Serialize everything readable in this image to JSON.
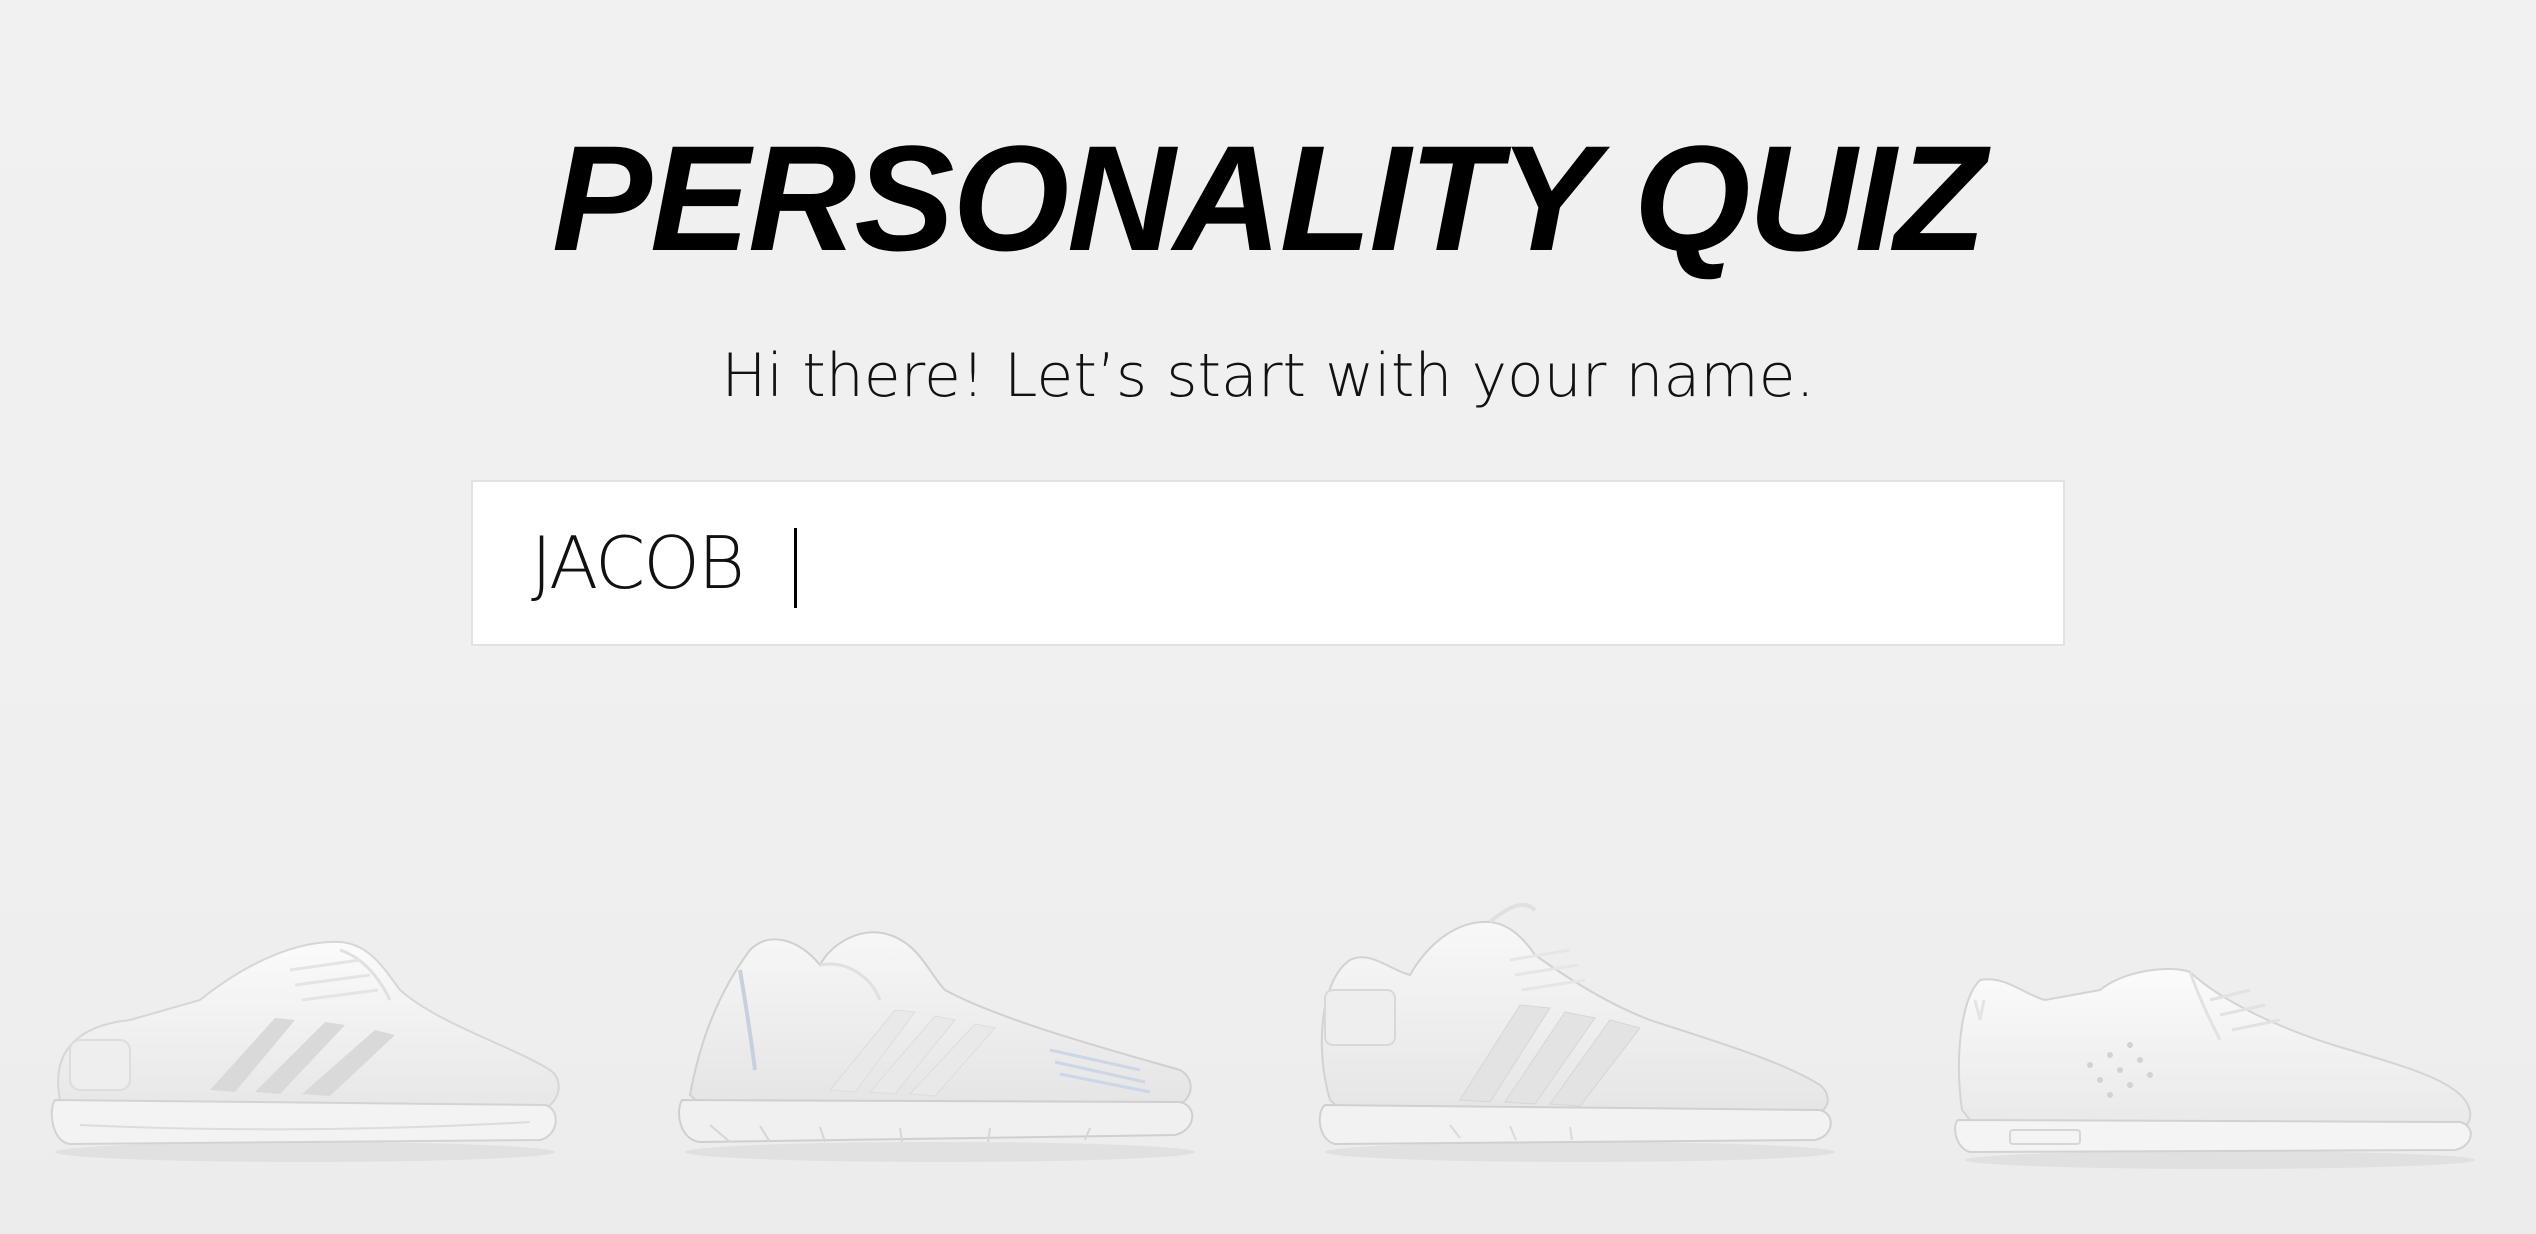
{
  "quiz": {
    "title": "PERSONALITY QUIZ",
    "subtitle": "Hi there! Let’s start with your name."
  },
  "name_field": {
    "value": "JACOB"
  },
  "shoes": [
    {
      "icon": "running-shoe-image"
    },
    {
      "icon": "knit-sneaker-image"
    },
    {
      "icon": "support-runner-image"
    },
    {
      "icon": "leather-court-shoe-image"
    }
  ]
}
